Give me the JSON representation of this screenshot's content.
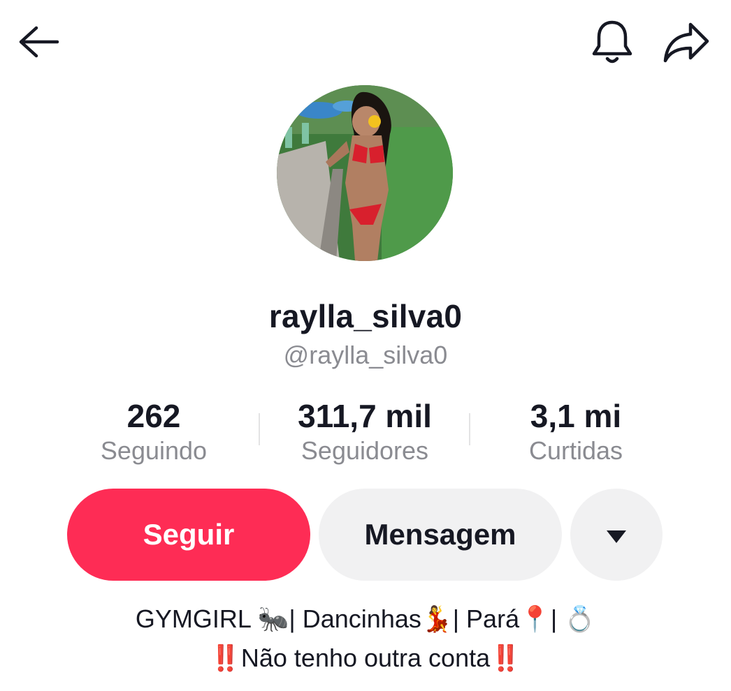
{
  "header": {
    "back_icon": "arrow-left-icon",
    "bell_icon": "bell-icon",
    "share_icon": "share-arrow-icon"
  },
  "profile": {
    "display_name": "raylla_silva0",
    "username": "@raylla_silva0",
    "avatar": "profile-photo"
  },
  "stats": [
    {
      "value": "262",
      "label": "Seguindo"
    },
    {
      "value": "311,7 mil",
      "label": "Seguidores"
    },
    {
      "value": "3,1 mi",
      "label": "Curtidas"
    }
  ],
  "actions": {
    "follow_label": "Seguir",
    "message_label": "Mensagem",
    "more_icon": "caret-down-icon"
  },
  "bio": {
    "line1": "GYMGIRL 🐜| Dancinhas💃| Pará📍| 💍",
    "line2": "‼️Não tenho outra conta‼️"
  },
  "colors": {
    "accent": "#fe2c55",
    "secondary_button": "#f1f1f2",
    "muted_text": "#8a8b91",
    "text": "#161823"
  }
}
